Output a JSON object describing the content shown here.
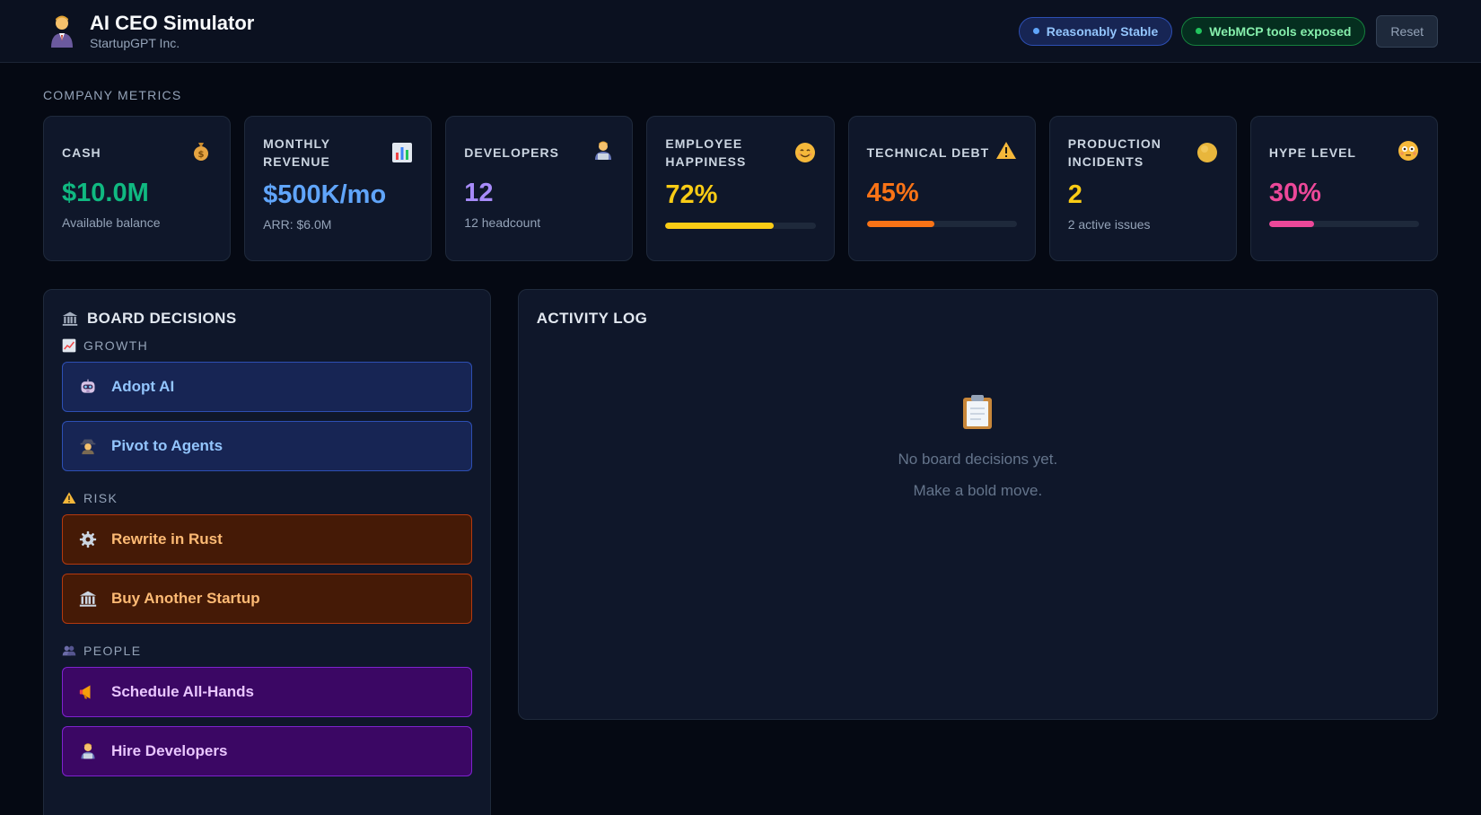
{
  "app": {
    "title": "AI CEO Simulator",
    "company": "StartupGPT Inc.",
    "status": "Reasonably Stable",
    "mcp_status": "WebMCP tools exposed",
    "reset_label": "Reset"
  },
  "metrics_section": "COMPANY METRICS",
  "metrics": {
    "cash": {
      "label": "CASH",
      "value": "$10.0M",
      "sub": "Available balance",
      "icon": "money-bag-icon",
      "color": "#10b981"
    },
    "revenue": {
      "label": "MONTHLY REVENUE",
      "value": "$500K/mo",
      "sub": "ARR: $6.0M",
      "icon": "bar-chart-icon",
      "color": "#60a5fa"
    },
    "developers": {
      "label": "DEVELOPERS",
      "value": "12",
      "sub": "12 headcount",
      "icon": "technologist-icon",
      "color": "#a78bfa"
    },
    "happiness": {
      "label": "EMPLOYEE HAPPINESS",
      "value": "72%",
      "level": 0.72,
      "icon": "smiling-face-icon",
      "color": "#facc15"
    },
    "tech_debt": {
      "label": "TECHNICAL DEBT",
      "value": "45%",
      "level": 0.45,
      "icon": "warning-icon",
      "color": "#f97316"
    },
    "incidents": {
      "label": "PRODUCTION INCIDENTS",
      "value": "2",
      "sub": "2 active issues",
      "icon": "yellow-circle-icon",
      "color": "#facc15"
    },
    "hype": {
      "label": "HYPE LEVEL",
      "value": "30%",
      "level": 0.3,
      "icon": "flushed-face-icon",
      "color": "#ec4899"
    }
  },
  "board": {
    "title": "BOARD DECISIONS",
    "groups": {
      "growth": {
        "title": "GROWTH",
        "items": [
          "Adopt AI",
          "Pivot to Agents"
        ]
      },
      "risk": {
        "title": "RISK",
        "items": [
          "Rewrite in Rust",
          "Buy Another Startup"
        ]
      },
      "people": {
        "title": "PEOPLE",
        "items": [
          "Schedule All-Hands",
          "Hire Developers"
        ]
      }
    }
  },
  "activity": {
    "title": "ACTIVITY LOG",
    "empty_line1": "No board decisions yet.",
    "empty_line2": "Make a bold move."
  }
}
